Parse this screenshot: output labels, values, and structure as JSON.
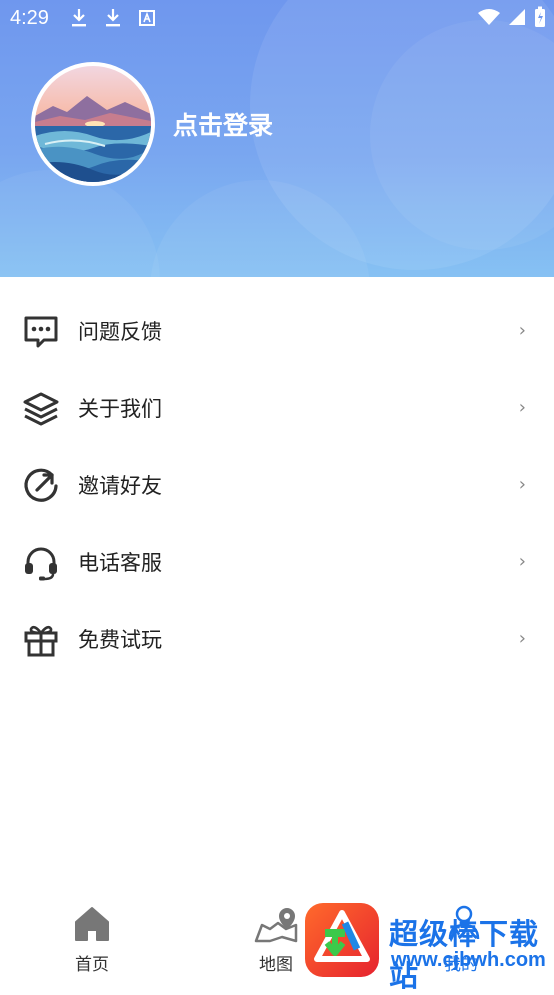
{
  "status_bar": {
    "time": "4:29"
  },
  "profile": {
    "login_label": "点击登录"
  },
  "menu": {
    "items": [
      {
        "label": "问题反馈",
        "icon": "chat-bubble-icon"
      },
      {
        "label": "关于我们",
        "icon": "layers-icon"
      },
      {
        "label": "邀请好友",
        "icon": "share-arrow-icon"
      },
      {
        "label": "电话客服",
        "icon": "headset-icon"
      },
      {
        "label": "免费试玩",
        "icon": "gift-icon"
      }
    ],
    "chevron": "›"
  },
  "tabbar": {
    "tabs": [
      {
        "label": "首页",
        "icon": "home-icon"
      },
      {
        "label": "地图",
        "icon": "map-pin-icon"
      },
      {
        "label": "我的",
        "icon": "user-icon"
      }
    ]
  },
  "watermark": {
    "title": "超级棒下载站",
    "url": "www.cjbwh.com"
  },
  "colors": {
    "header_top": "#6f97ee",
    "header_bottom": "#86c1f3",
    "icon": "#333333",
    "brand": "#1b73e8"
  }
}
